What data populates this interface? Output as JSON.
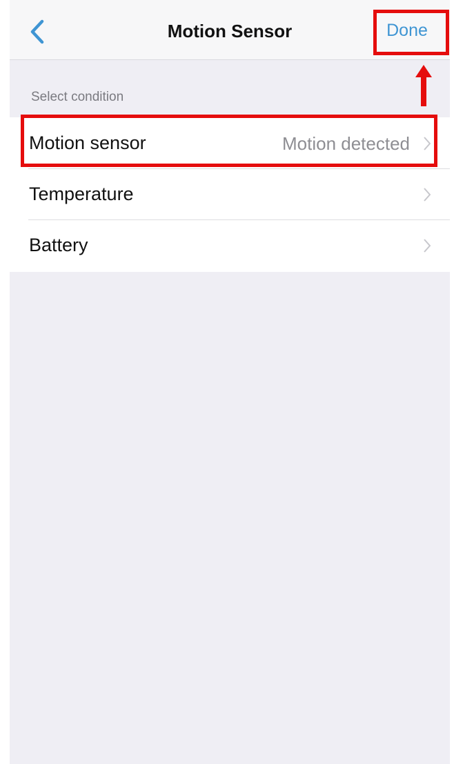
{
  "navbar": {
    "back_icon": "chevron-left-icon",
    "title": "Motion Sensor",
    "done_label": "Done"
  },
  "section": {
    "header": "Select condition"
  },
  "conditions": [
    {
      "label": "Motion sensor",
      "value": "Motion detected",
      "icon": "chevron-right-icon"
    },
    {
      "label": "Temperature",
      "value": "",
      "icon": "chevron-right-icon"
    },
    {
      "label": "Battery",
      "value": "",
      "icon": "chevron-right-icon"
    }
  ],
  "colors": {
    "accent": "#3f95d3",
    "annotation": "#e50d0d",
    "background": "#efeef4",
    "secondary_text": "#8e8e93"
  }
}
